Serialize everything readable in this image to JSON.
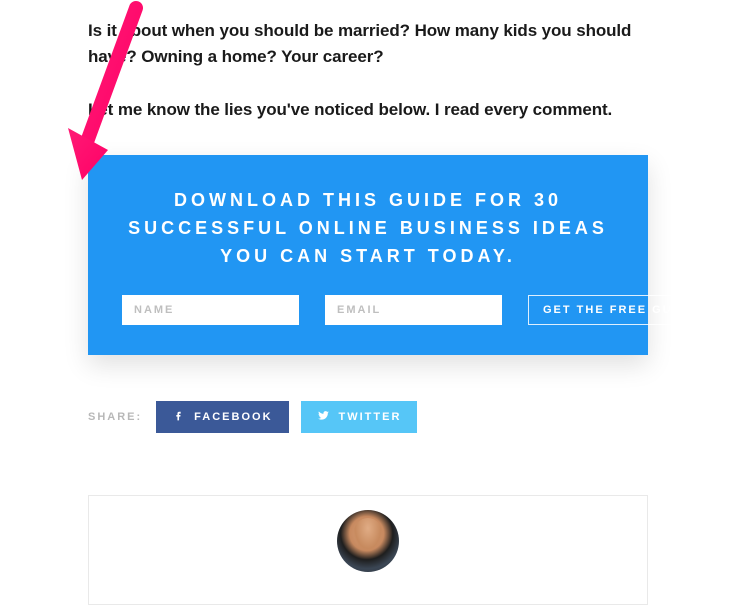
{
  "article": {
    "paragraph1": "Is it about when you should be married? How many kids you should have? Owning a home? Your career?",
    "paragraph2": "Let me know the lies you've noticed below. I read every comment."
  },
  "optin": {
    "headline": "DOWNLOAD THIS GUIDE FOR 30 SUCCESSFUL ONLINE BUSINESS IDEAS YOU CAN START TODAY.",
    "name_placeholder": "NAME",
    "email_placeholder": "EMAIL",
    "button_label": "GET THE FREE GUIDE!"
  },
  "share": {
    "label": "SHARE:",
    "facebook_label": "FACEBOOK",
    "twitter_label": "TWITTER"
  },
  "annotation": {
    "arrow_icon": "arrow-pointer"
  }
}
